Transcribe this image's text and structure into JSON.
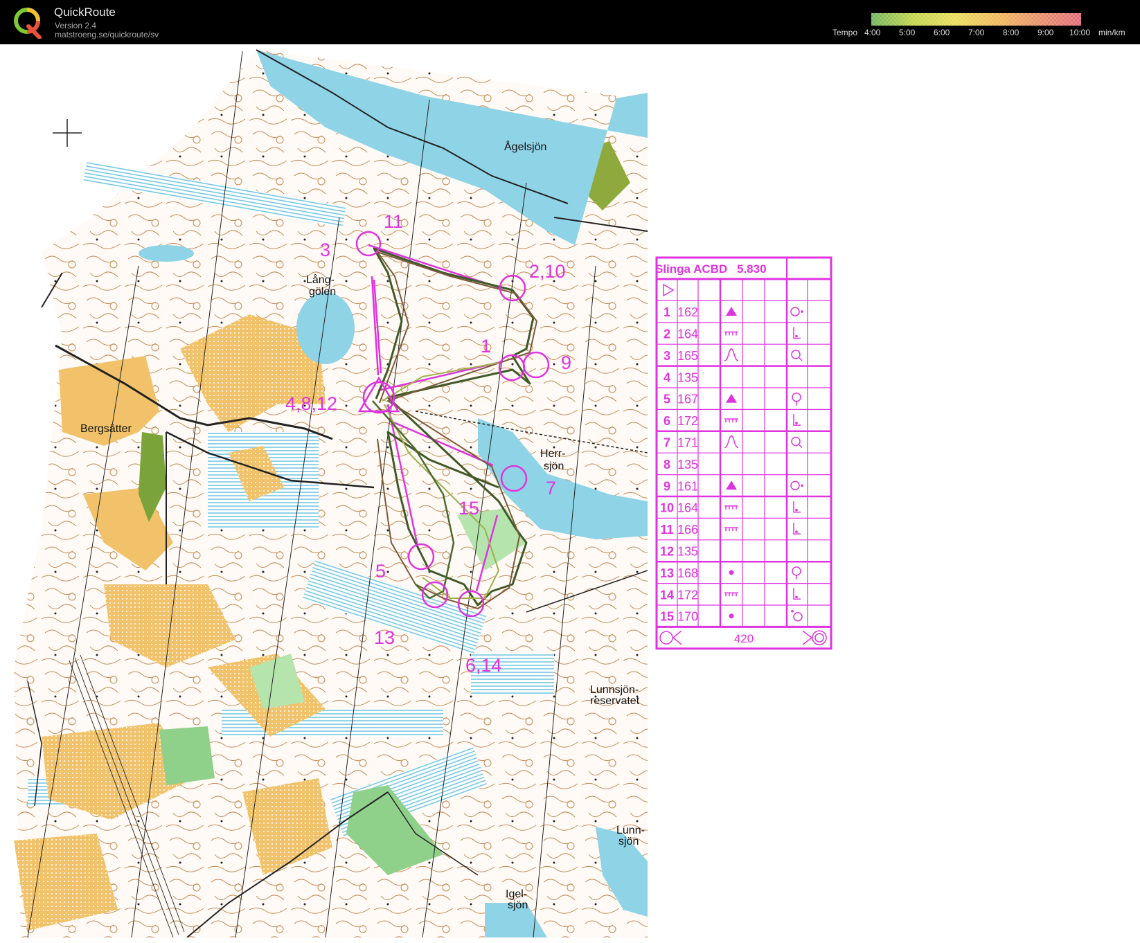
{
  "app": {
    "title": "QuickRoute",
    "version": "Version 2.4",
    "url": "matstroeng.se/quickroute/sv"
  },
  "tempo_legend": {
    "label": "Tempo",
    "ticks": [
      "4:00",
      "5:00",
      "6:00",
      "7:00",
      "8:00",
      "9:00",
      "10:00"
    ],
    "unit": "min/km",
    "colors": [
      "#6fb35a",
      "#c2d44a",
      "#e8dc5a",
      "#f0b85a",
      "#e88f6a",
      "#e06a78"
    ]
  },
  "map": {
    "place_names": {
      "agelsjon": "Ågelsjön",
      "langgolen_1": "Lång-",
      "langgolen_2": "gölen",
      "bergsatter": "Bergsätter",
      "herrsjon_1": "Herr-",
      "herrsjon_2": "sjön",
      "lunnsjon_res_1": "Lunnsjön-",
      "lunnsjon_res_2": "reservatet",
      "lunnsjon_1": "Lunn-",
      "lunnsjon_2": "sjön",
      "igelsjon_1": "Igel-",
      "igelsjon_2": "sjön"
    },
    "control_numbers": {
      "c3": "3",
      "c11": "11",
      "c2_10": "2,10",
      "c1": "1",
      "c9": "9",
      "c4_8_12": "4,8,12",
      "c15": "15",
      "c7": "7",
      "c5": "5",
      "c13": "13",
      "c6_14": "6,14"
    },
    "colors": {
      "water": "#8fd3e6",
      "contour": "#c48a55",
      "open_land": "#f2c26a",
      "green": "#8fd08a",
      "course": "#e033e0",
      "route": "#3f5a2a"
    }
  },
  "control_description": {
    "course_name": "Slinga ACBD",
    "course_length": "5.830",
    "rows": [
      {
        "num": "1",
        "code": "162",
        "feature": "knoll-symbol",
        "detail": "ring-dot-symbol"
      },
      {
        "num": "2",
        "code": "164",
        "feature": "cliff-symbol",
        "detail": "foot-symbol"
      },
      {
        "num": "3",
        "code": "165",
        "feature": "spur-symbol",
        "detail": "ring-tail-symbol"
      },
      {
        "num": "4",
        "code": "135",
        "feature": "",
        "detail": ""
      },
      {
        "num": "5",
        "code": "167",
        "feature": "knoll-symbol",
        "detail": "ring-drop-symbol"
      },
      {
        "num": "6",
        "code": "172",
        "feature": "cliff-symbol",
        "detail": "foot-symbol"
      },
      {
        "num": "7",
        "code": "171",
        "feature": "spur-symbol",
        "detail": "ring-tail-symbol"
      },
      {
        "num": "8",
        "code": "135",
        "feature": "",
        "detail": ""
      },
      {
        "num": "9",
        "code": "161",
        "feature": "knoll-symbol",
        "detail": "ring-dot-symbol"
      },
      {
        "num": "10",
        "code": "164",
        "feature": "cliff-symbol",
        "detail": "foot-symbol"
      },
      {
        "num": "11",
        "code": "166",
        "feature": "cliff-symbol",
        "detail": "foot-symbol"
      },
      {
        "num": "12",
        "code": "135",
        "feature": "",
        "detail": ""
      },
      {
        "num": "13",
        "code": "168",
        "feature": "boulder-symbol",
        "detail": "ring-drop-symbol"
      },
      {
        "num": "14",
        "code": "172",
        "feature": "cliff-symbol",
        "detail": "foot-symbol"
      },
      {
        "num": "15",
        "code": "170",
        "feature": "boulder-symbol",
        "detail": "ring-dot-left-symbol"
      }
    ],
    "finish_distance": "420"
  }
}
